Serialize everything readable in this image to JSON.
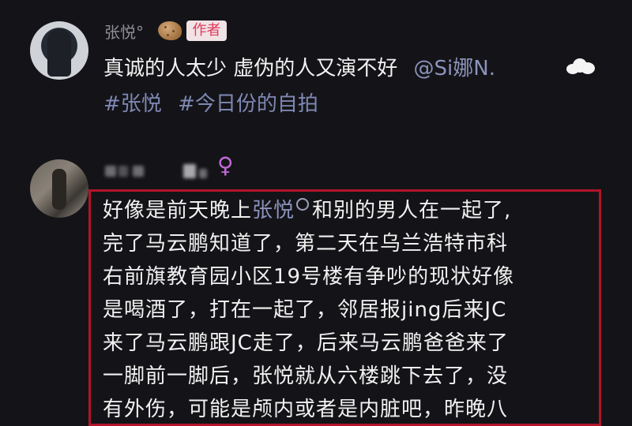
{
  "author": {
    "name": "张悦°",
    "badge": "作者",
    "post_text": "真诚的人太少 虚伪的人又演不好",
    "mention": "@Si娜N.",
    "tags": [
      "#张悦",
      "#今日份的自拍"
    ]
  },
  "comment": {
    "lines": [
      {
        "before": "好像是前天晚上",
        "link": "张悦",
        "after": "和别的男人在一起了,"
      },
      {
        "text": "完了马云鹏知道了，第二天在乌兰浩特市科"
      },
      {
        "text": "右前旗教育园小区19号楼有争吵的现状好像"
      },
      {
        "text": "是喝酒了，打在一起了，邻居报jing后来JC"
      },
      {
        "text": "来了马云鹏跟JC走了，后来马云鹏爸爸来了"
      },
      {
        "text": "一脚前一脚后，张悦就从六楼跳下去了，没"
      },
      {
        "text": "有外伤，可能是颅内或者是内脏吧，昨晚八"
      }
    ],
    "gender_icon": "female-icon",
    "highlight_color": "#b2142a"
  }
}
